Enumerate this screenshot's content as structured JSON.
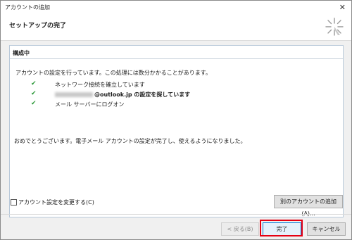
{
  "window": {
    "title": "アカウントの追加",
    "close_glyph": "✕"
  },
  "header": {
    "title": "セットアップの完了",
    "icon": "sparkle-icon"
  },
  "section": {
    "title": "構成中"
  },
  "description": "アカウントの設定を行っています。この処理には数分かかることがあります。",
  "steps": [
    {
      "check": "✔",
      "text": "ネットワーク接続を確立しています"
    },
    {
      "check": "✔",
      "text": "@outlook.jp の設定を探しています"
    },
    {
      "check": "✔",
      "text": "メール サーバーにログオン"
    }
  ],
  "done_message": "おめでとうございます。電子メール アカウントの設定が完了し、使えるようになりました。",
  "change_settings_label": "アカウント設定を変更する(C)",
  "add_another_label": "別のアカウントの追加(A)...",
  "buttons": {
    "back": "< 戻る(B)",
    "finish": "完了",
    "cancel": "キャンセル"
  },
  "colors": {
    "check": "#2f9a3b",
    "highlight": "#e60012",
    "accent": "#0078d7"
  }
}
